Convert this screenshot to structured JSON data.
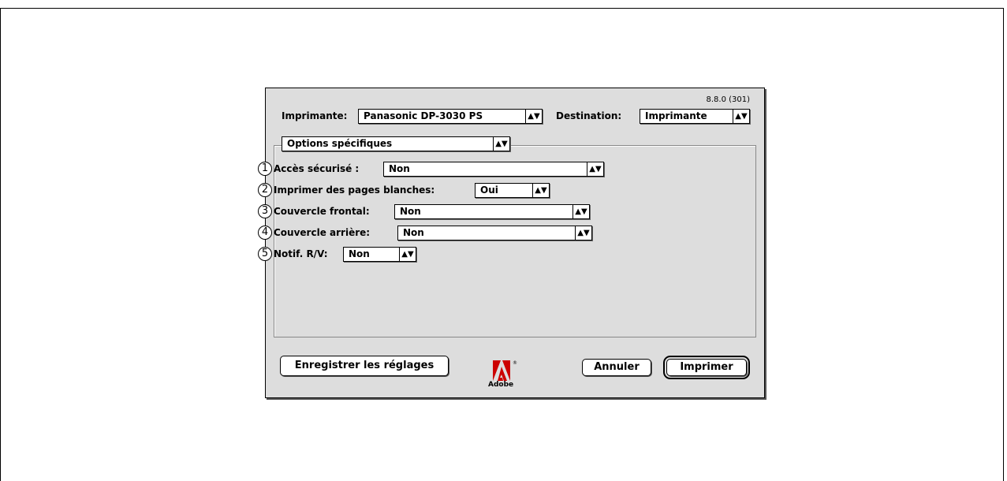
{
  "version": "8.8.0 (301)",
  "header": {
    "printer_label": "Imprimante:",
    "printer_value": "Panasonic DP-3030 PS",
    "destination_label": "Destination:",
    "destination_value": "Imprimante"
  },
  "panel": {
    "selected": "Options spécifiques"
  },
  "options": [
    {
      "num": "1",
      "label": "Accès sécurisé :",
      "value": "Non"
    },
    {
      "num": "2",
      "label": "Imprimer des pages blanches:",
      "value": "Oui"
    },
    {
      "num": "3",
      "label": "Couvercle frontal:",
      "value": "Non"
    },
    {
      "num": "4",
      "label": "Couvercle arrière:",
      "value": "Non"
    },
    {
      "num": "5",
      "label": "Notif. R/V:",
      "value": "Non"
    }
  ],
  "buttons": {
    "save": "Enregistrer les réglages",
    "cancel": "Annuler",
    "print": "Imprimer"
  },
  "logo": {
    "text": "Adobe",
    "color": "#cc0000"
  },
  "icons": {
    "popup_arrows": "up-down-arrows-icon",
    "circled_numbers": "circled-number-icon"
  }
}
